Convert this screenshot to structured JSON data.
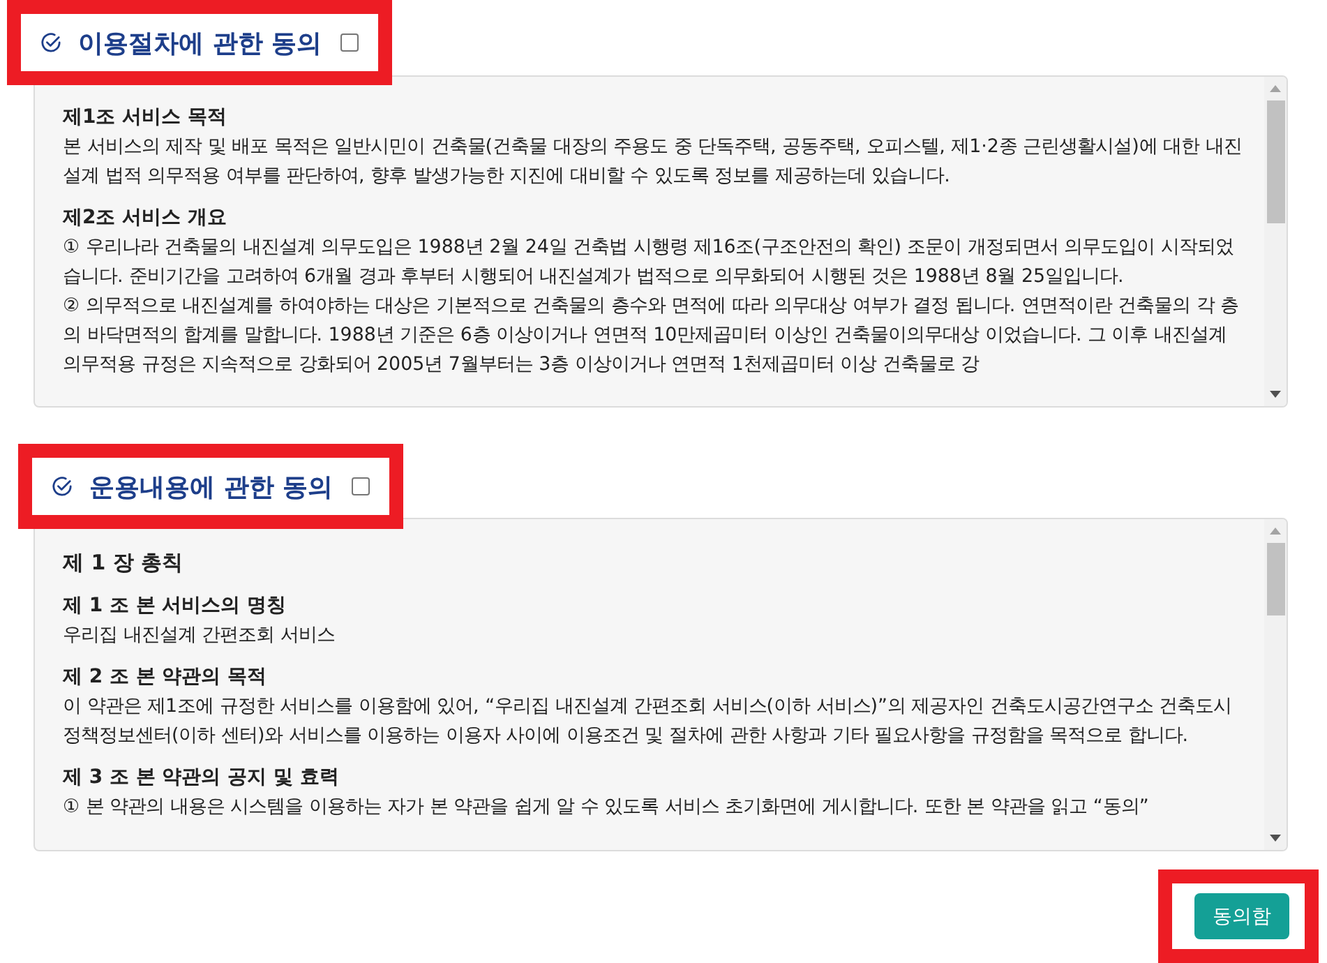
{
  "sections": [
    {
      "title": "이용절차에 관한 동의",
      "highlighted": true,
      "checked": false,
      "content": [
        {
          "kind": "heading",
          "text": "제1조 서비스 목적"
        },
        {
          "kind": "paragraph",
          "text": "본 서비스의 제작 및 배포 목적은 일반시민이 건축물(건축물 대장의 주용도 중 단독주택, 공동주택, 오피스텔, 제1·2종 근린생활시설)에 대한 내진설계 법적 의무적용 여부를 판단하여, 향후 발생가능한 지진에 대비할 수 있도록 정보를 제공하는데 있습니다."
        },
        {
          "kind": "heading",
          "text": "제2조 서비스 개요"
        },
        {
          "kind": "paragraph",
          "text": "① 우리나라 건축물의 내진설계 의무도입은 1988년 2월 24일 건축법 시행령 제16조(구조안전의 확인) 조문이 개정되면서 의무도입이 시작되었습니다. 준비기간을 고려하여 6개월 경과 후부터 시행되어 내진설계가 법적으로 의무화되어 시행된 것은 1988년 8월 25일입니다."
        },
        {
          "kind": "paragraph",
          "text": "② 의무적으로 내진설계를 하여야하는 대상은 기본적으로 건축물의 층수와 면적에 따라 의무대상 여부가 결정 됩니다. 연면적이란 건축물의 각 층의 바닥면적의 합계를 말합니다. 1988년 기준은 6층 이상이거나 연면적 10만제곱미터 이상인 건축물이의무대상 이었습니다. 그 이후 내진설계 의무적용 규정은 지속적으로 강화되어 2005년 7월부터는 3층 이상이거나 연면적 1천제곱미터 이상 건축물로 강"
        }
      ]
    },
    {
      "title": "운용내용에 관한 동의",
      "highlighted": true,
      "checked": false,
      "content": [
        {
          "kind": "chapter",
          "text": "제 1 장 총칙"
        },
        {
          "kind": "heading",
          "text": "제 1 조 본 서비스의 명칭"
        },
        {
          "kind": "paragraph",
          "text": "우리집 내진설계 간편조회 서비스"
        },
        {
          "kind": "heading",
          "text": "제 2 조 본 약관의 목적"
        },
        {
          "kind": "paragraph",
          "text": "이 약관은 제1조에 규정한 서비스를 이용함에 있어, “우리집 내진설계 간편조회 서비스(이하 서비스)”의 제공자인 건축도시공간연구소 건축도시정책정보센터(이하 센터)와 서비스를 이용하는 이용자 사이에 이용조건 및 절차에 관한 사항과 기타 필요사항을 규정함을 목적으로 합니다."
        },
        {
          "kind": "heading",
          "text": "제 3 조 본 약관의 공지 및 효력"
        },
        {
          "kind": "paragraph",
          "text": "① 본 약관의 내용은 시스템을 이용하는 자가 본 약관을 쉽게 알 수 있도록 서비스 초기화면에 게시합니다. 또한 본 약관을 읽고 “동의”"
        }
      ]
    }
  ],
  "agree_button": {
    "label": "동의함",
    "highlighted": true
  }
}
